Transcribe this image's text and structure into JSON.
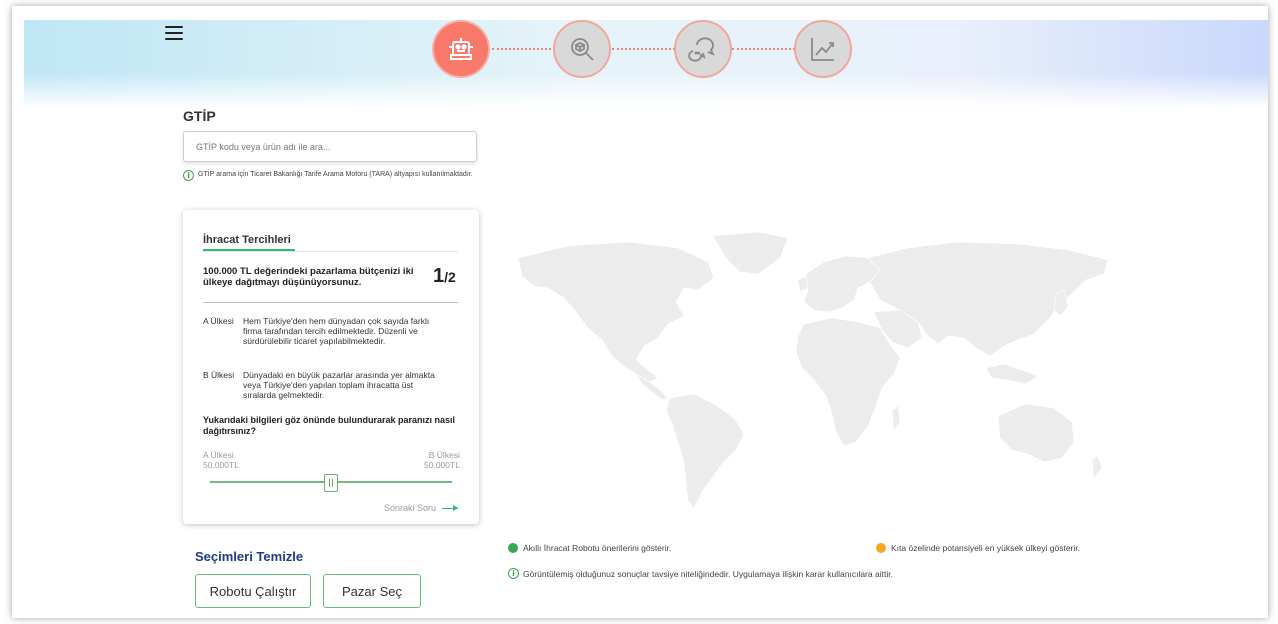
{
  "colors": {
    "accent_green": "#2eb872",
    "step_active": "#f8786a",
    "step_inactive": "#d9d9d9",
    "link_blue": "#1e3a8a",
    "legend_green": "#3aa756",
    "legend_orange": "#f5a623",
    "map_land": "#ececec"
  },
  "header": {
    "menu_icon": "hamburger-menu-icon",
    "steps": [
      {
        "icon": "robot-icon",
        "state": "active"
      },
      {
        "icon": "package-search-icon",
        "state": "inactive"
      },
      {
        "icon": "chat-bubbles-icon",
        "state": "inactive"
      },
      {
        "icon": "trend-chart-icon",
        "state": "inactive"
      }
    ]
  },
  "gtip": {
    "label": "GTİP",
    "placeholder": "GTİP kodu veya ürün adı ile ara...",
    "value": "",
    "info_text": "GTİP arama için Ticaret Bakanlığı Tarife Arama Motoru (TARA) altyapısı kullanılmaktadır."
  },
  "card": {
    "title": "İhracat Tercihleri",
    "question": "100.000 TL değerindeki pazarlama bütçenizi iki ülkeye dağıtmayı düşünüyorsunuz.",
    "counter_current": "1",
    "counter_total": "/2",
    "options": [
      {
        "label": "A Ülkesi",
        "text": "Hem Türkiye'den hem dünyadan çok sayıda farklı firma tarafından tercih edilmektedir. Düzenli ve sürdürülebilir ticaret yapılabilmektedir."
      },
      {
        "label": "B Ülkesi",
        "text": "Dünyadaki en büyük pazarlar arasında yer almakta veya Türkiye'den yapılan toplam ihracatta üst sıralarda gelmektedir."
      }
    ],
    "prompt": "Yukarıdaki bilgileri göz önünde bulundurarak paranızı nasıl dağıtırsınız?",
    "slider": {
      "a_label": "A Ülkesi",
      "a_value": "50.000TL",
      "b_label": "B Ülkesi",
      "b_value": "50.000TL",
      "position_percent": 50
    },
    "next_label": "Sonraki Soru"
  },
  "actions": {
    "clear_label": "Seçimleri Temizle",
    "run_label": "Robotu Çalıştır",
    "market_label": "Pazar Seç"
  },
  "legend": {
    "green_text": "Akıllı İhracat Robotu önerilerini gösterir.",
    "orange_text": "Kıta özelinde potansiyeli en yüksek ülkeyi gösterir."
  },
  "disclaimer": "Görüntülemiş olduğunuz sonuçlar tavsiye niteliğindedir. Uygulamaya ilişkin karar kullanıcılara aittir."
}
